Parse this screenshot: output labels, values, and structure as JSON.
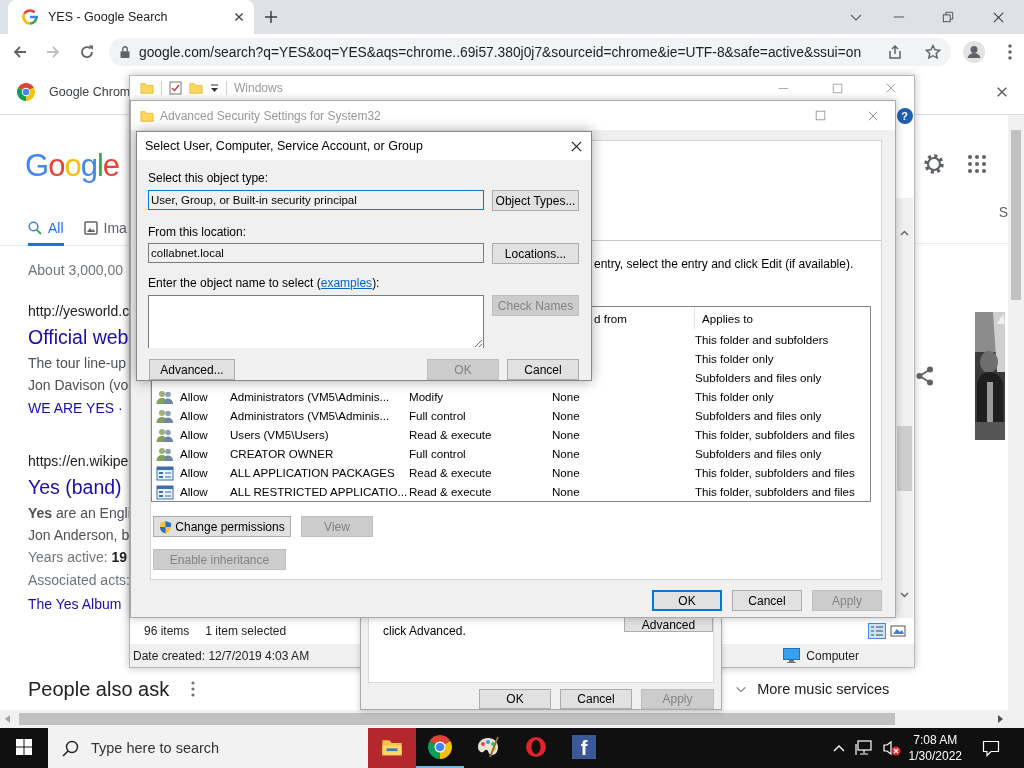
{
  "browser": {
    "tab": {
      "title": "YES - Google Search",
      "selected": true
    },
    "address": "google.com/search?q=YES&oq=YES&aqs=chrome..69i57.380j0j7&sourceid=chrome&ie=UTF-8&safe=active&ssui=on",
    "infobar": "Google Chrom",
    "page": {
      "logo": "Google",
      "tabs": [
        {
          "label": "All",
          "selected": true
        },
        {
          "label": "Ima",
          "selected": false
        }
      ],
      "stats": "About 3,000,00",
      "results": [
        {
          "kind": "url",
          "text": "http://yesworld.c"
        },
        {
          "kind": "title",
          "text": "Official web"
        },
        {
          "kind": "snippet",
          "text": "The tour line-up"
        },
        {
          "kind": "snippet",
          "text": "Jon Davison (vo"
        },
        {
          "kind": "sitelink",
          "text": "WE ARE YES ·"
        },
        {
          "kind": "url",
          "text": "https://en.wikipe"
        },
        {
          "kind": "title",
          "text": "Yes (band)"
        },
        {
          "kind": "snippet",
          "text": "**Yes** are an Engli"
        },
        {
          "kind": "snippet",
          "text": "Jon Anderson, b"
        },
        {
          "kind": "fact",
          "text": "Years active: **19**"
        },
        {
          "kind": "fact",
          "text": "Associated acts:"
        },
        {
          "kind": "sitelink",
          "text": "The Yes Album"
        }
      ],
      "side_tab": "S",
      "people_also_ask": "People also ask",
      "more": "More music services"
    }
  },
  "explorer": {
    "title": "Windows",
    "help": "?",
    "items": "96 items",
    "selection": "1 item selected",
    "date_created": "Date created: 12/7/2019 4:03 AM",
    "location": "Computer"
  },
  "properties": {
    "note": "click Advanced.",
    "advanced_button": "Advanced",
    "buttons": [
      {
        "label": "OK",
        "disabled": false
      },
      {
        "label": "Cancel",
        "disabled": false
      },
      {
        "label": "Apply",
        "disabled": true
      }
    ]
  },
  "advanced": {
    "title": "Advanced Security Settings for System32",
    "instruction": "entry, select the entry and click Edit (if available).",
    "columns": [
      "d from",
      "Applies to"
    ],
    "entries": [
      {
        "applies_to": "This folder and subfolders"
      },
      {
        "applies_to": "This folder only"
      },
      {
        "applies_to": "Subfolders and files only"
      },
      {
        "kind": "group",
        "type": "Allow",
        "principal": "Administrators (VM5\\Adminis...",
        "access": "Modify",
        "inherited": "None",
        "applies_to": "This folder only"
      },
      {
        "kind": "group",
        "type": "Allow",
        "principal": "Administrators (VM5\\Adminis...",
        "access": "Full control",
        "inherited": "None",
        "applies_to": "Subfolders and files only"
      },
      {
        "kind": "group",
        "type": "Allow",
        "principal": "Users (VM5\\Users)",
        "access": "Read & execute",
        "inherited": "None",
        "applies_to": "This folder, subfolders and files"
      },
      {
        "kind": "group",
        "type": "Allow",
        "principal": "CREATOR OWNER",
        "access": "Full control",
        "inherited": "None",
        "applies_to": "Subfolders and files only"
      },
      {
        "kind": "package",
        "type": "Allow",
        "principal": "ALL APPLICATION PACKAGES",
        "access": "Read & execute",
        "inherited": "None",
        "applies_to": "This folder, subfolders and files"
      },
      {
        "kind": "package",
        "type": "Allow",
        "principal": "ALL RESTRICTED APPLICATIO...",
        "access": "Read & execute",
        "inherited": "None",
        "applies_to": "This folder, subfolders and files"
      }
    ],
    "actions": [
      {
        "label": "Change permissions",
        "disabled": false,
        "shield": true
      },
      {
        "label": "View",
        "disabled": true,
        "shield": false
      }
    ],
    "inheritance": {
      "label": "Enable inheritance",
      "disabled": true
    },
    "buttons": [
      {
        "label": "OK",
        "disabled": false,
        "default": true
      },
      {
        "label": "Cancel",
        "disabled": false,
        "default": false
      },
      {
        "label": "Apply",
        "disabled": true,
        "default": false
      }
    ]
  },
  "select_dialog": {
    "title": "Select User, Computer, Service Account, or Group",
    "object_type_label": "Select this object type:",
    "object_type": "User, Group, or Built-in security principal",
    "object_types_button": "Object Types...",
    "location_label": "From this location:",
    "location": "collabnet.local",
    "locations_button": "Locations...",
    "name_label": {
      "before": "Enter the object name to select (",
      "link": "examples",
      "after": "):"
    },
    "check_names": {
      "label": "Check Names",
      "disabled": true
    },
    "advanced_button": "Advanced...",
    "buttons": [
      {
        "label": "OK",
        "disabled": true
      },
      {
        "label": "Cancel",
        "disabled": false
      }
    ]
  },
  "taskbar": {
    "search_placeholder": "Type here to search",
    "apps": [
      {
        "kind": "folder",
        "active": true,
        "running": false
      },
      {
        "kind": "browser",
        "active": false,
        "running": true
      },
      {
        "kind": "paint",
        "active": false,
        "running": false
      },
      {
        "kind": "ring",
        "active": false,
        "running": false
      },
      {
        "kind": "letter",
        "glyph": "f",
        "active": false,
        "running": false
      }
    ],
    "time": "7:08 AM",
    "date": "1/30/2022",
    "volume_muted": true
  }
}
